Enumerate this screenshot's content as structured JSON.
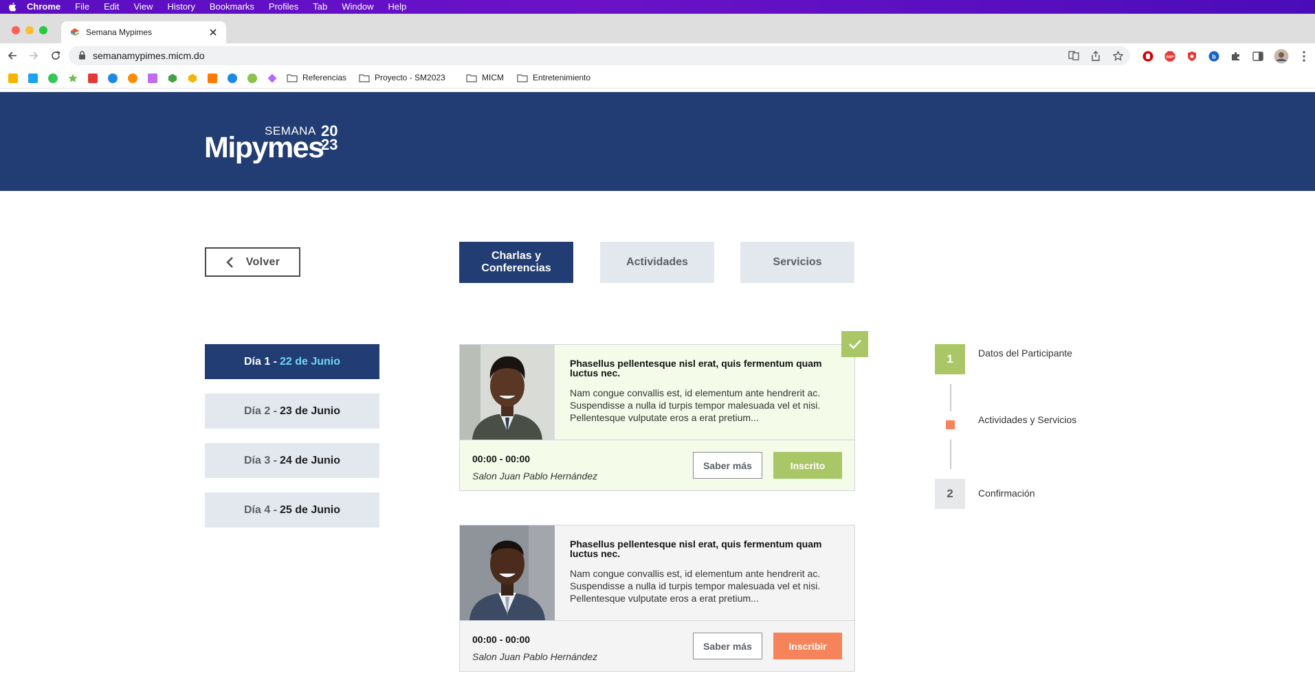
{
  "menubar": {
    "items": [
      "Chrome",
      "File",
      "Edit",
      "View",
      "History",
      "Bookmarks",
      "Profiles",
      "Tab",
      "Window",
      "Help"
    ]
  },
  "browser": {
    "tab_title": "Semana Mypimes",
    "url": "semanamypimes.micm.do",
    "bookmark_folders": [
      "Referencias",
      "Proyecto - SM2023",
      "MICM",
      "Entretenimiento"
    ],
    "bookmark_icon_colors": [
      "#f7b500",
      "#1da1f2",
      "#34c759",
      "#6cc04a",
      "#e53935",
      "#1e88e5",
      "#fb8c00",
      "#c06bf0",
      "#43a047",
      "#f4b400",
      "#ff7a00",
      "#1e88e5",
      "#8bc34a",
      "#b569f7"
    ]
  },
  "site": {
    "logo": {
      "semana": "SEMANA",
      "name": "Mipymes",
      "year_top": "20",
      "year_bottom": "23"
    },
    "back_label": "Volver",
    "categories": [
      {
        "label": "Charlas y Conferencias",
        "active": true
      },
      {
        "label": "Actividades",
        "active": false
      },
      {
        "label": "Servicios",
        "active": false
      }
    ],
    "days": [
      {
        "prefix": "Día 1 -",
        "date": "22 de Junio",
        "active": true
      },
      {
        "prefix": "Día 2 -",
        "date": "23 de Junio",
        "active": false
      },
      {
        "prefix": "Día 3 -",
        "date": "24 de Junio",
        "active": false
      },
      {
        "prefix": "Día 4 -",
        "date": "25 de Junio",
        "active": false
      }
    ],
    "events": [
      {
        "title": "Phasellus pellentesque nisl erat, quis fermentum quam luctus nec.",
        "description": "Nam congue convallis est, id elementum ante hendrerit ac. Suspendisse a nulla id turpis tempor malesuada vel et nisi. Pellentesque vulputate eros a erat pretium...",
        "time": "00:00 - 00:00",
        "room": "Salon Juan Pablo Hernández",
        "more_label": "Saber más",
        "action_label": "Inscrito",
        "enrolled": true
      },
      {
        "title": "Phasellus pellentesque nisl erat, quis fermentum quam luctus nec.",
        "description": "Nam congue convallis est, id elementum ante hendrerit ac. Suspendisse a nulla id turpis tempor malesuada vel et nisi. Pellentesque vulputate eros a erat pretium...",
        "time": "00:00 - 00:00",
        "room": "Salon Juan Pablo Hernández",
        "more_label": "Saber más",
        "action_label": "Inscribir",
        "enrolled": false
      }
    ],
    "steps": [
      {
        "number": "1",
        "label": "Datos del Participante",
        "state": "done"
      },
      {
        "number": "",
        "label": "Actividades y Servicios",
        "state": "current"
      },
      {
        "number": "2",
        "label": "Confirmación",
        "state": "todo"
      }
    ]
  },
  "colors": {
    "navy": "#223d73",
    "green": "#a9c766",
    "orange": "#f5845a",
    "light_gray": "#e3e8ee",
    "highlight_date": "#6fd7f5"
  }
}
